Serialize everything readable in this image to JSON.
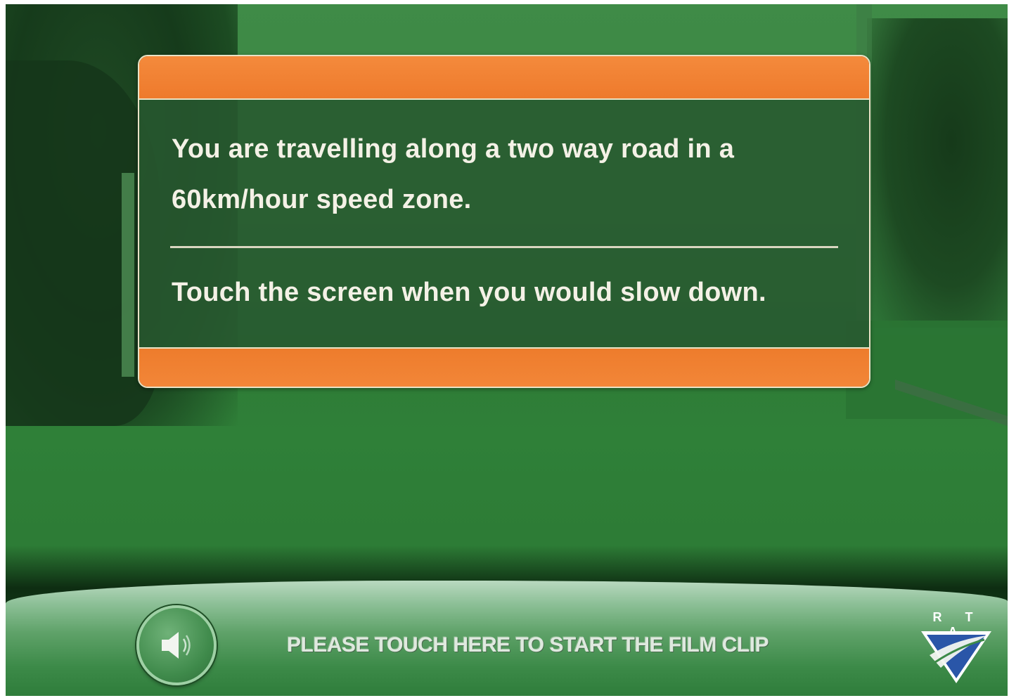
{
  "panel": {
    "instruction_line": "You are travelling along a two way road in a 60km/hour speed zone.",
    "action_line": "Touch the screen when you would slow down."
  },
  "footer": {
    "start_clip_label": "PLEASE TOUCH HERE TO START THE FILM CLIP",
    "sound_icon": "speaker-icon"
  },
  "logo": {
    "text": "RTA",
    "letters": "R T A"
  },
  "colors": {
    "accent_orange": "#f0802f",
    "panel_green": "#28582f",
    "background_green": "#2f7a3c",
    "text_light": "#f4f1e6"
  }
}
